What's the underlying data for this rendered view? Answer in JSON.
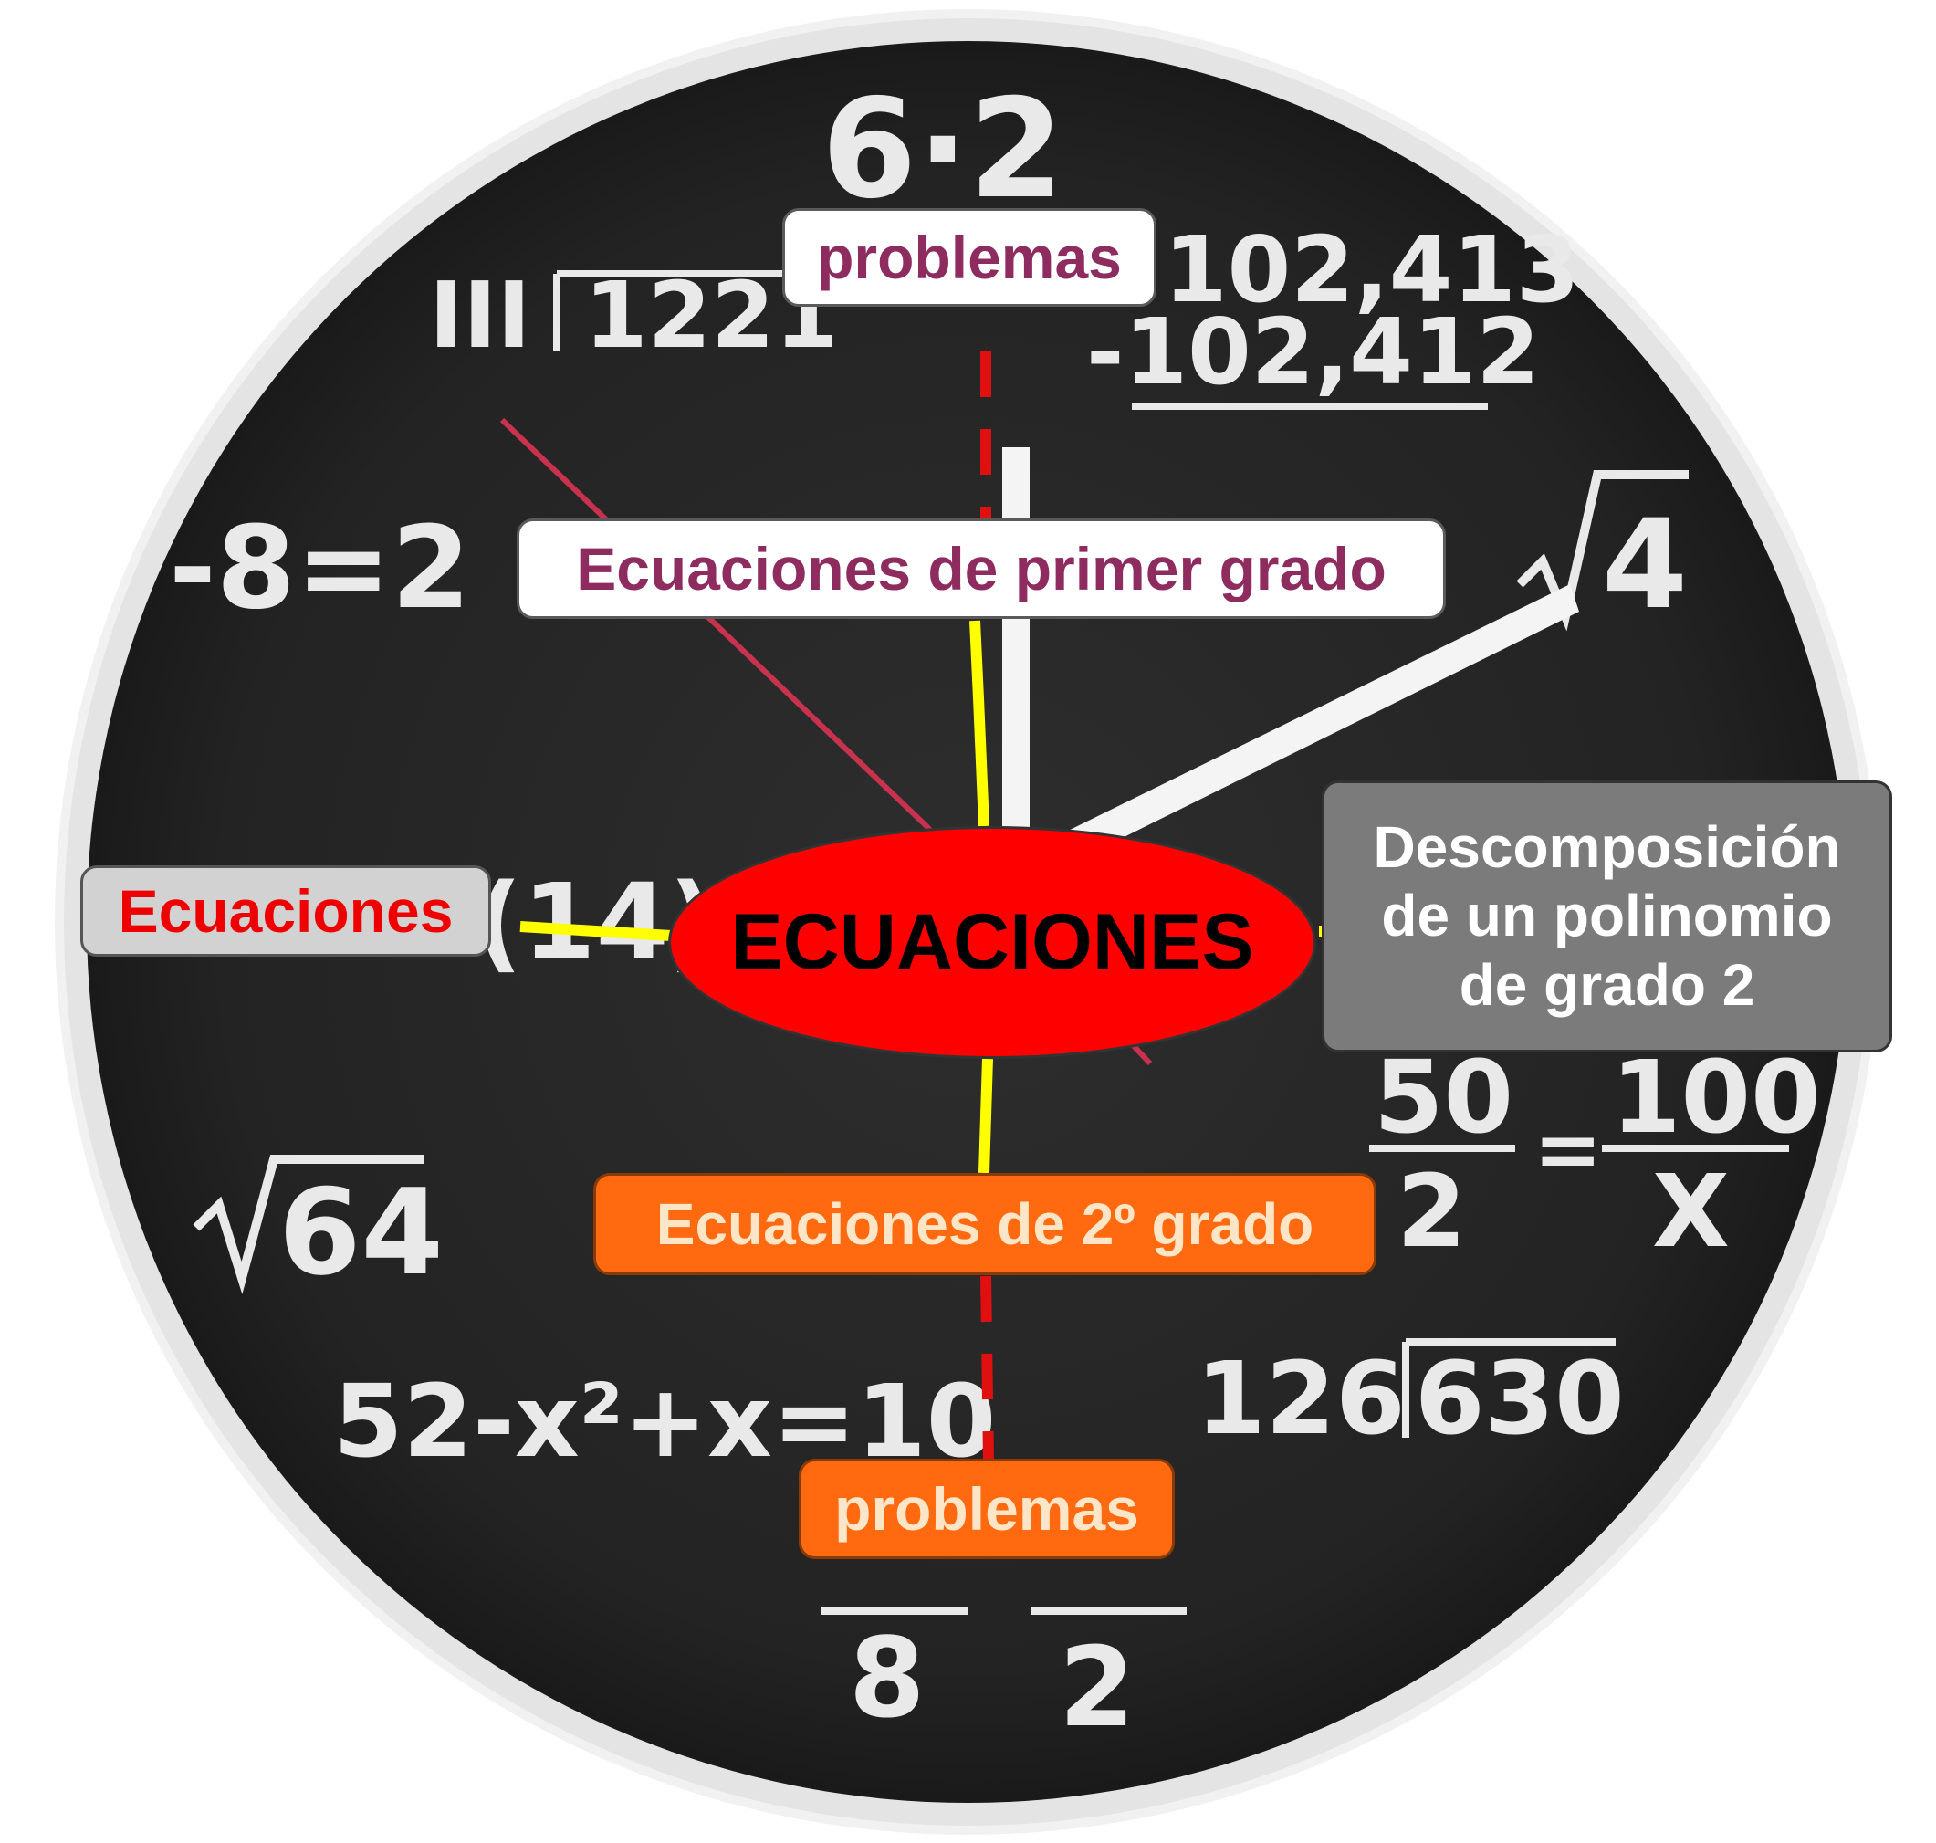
{
  "colors": {
    "central_fill": "#ff0000",
    "connector_yellow": "#ffff00",
    "connector_red_dashed": "#e01010",
    "white_node_text": "#8e2c5f",
    "orange_node_fill": "#ff6a10",
    "grey_node_fill": "#7b7b7b",
    "clock_face": "#262626"
  },
  "diagram": {
    "central": "ECUACIONES",
    "nodes": {
      "primer_grado": "Ecuaciones de primer grado",
      "problemas_top": "problemas",
      "segundo_grado": "Ecuaciones de 2º grado",
      "problemas_bottom": "problemas",
      "descomposicion": "Descomposición de un polinomio de grado 2",
      "ecuaciones_left": "Ecuaciones"
    }
  },
  "background": {
    "chalk": {
      "top": "6·2",
      "div_left_a": "III",
      "div_left_b": "1221",
      "sub_a": "102,413",
      "sub_b": "-102,412",
      "left_eq": "-8=2",
      "sqrt4": "4",
      "nine": "(14)",
      "frac_a_num": "50",
      "frac_a_den": "2",
      "frac_b_num": "100",
      "frac_b_den": "X",
      "sqrt64": "64",
      "eq52": "52-x²+x=10",
      "div126": "126",
      "div630": "630",
      "frac_c_den": "8",
      "frac_d_den": "2"
    }
  }
}
